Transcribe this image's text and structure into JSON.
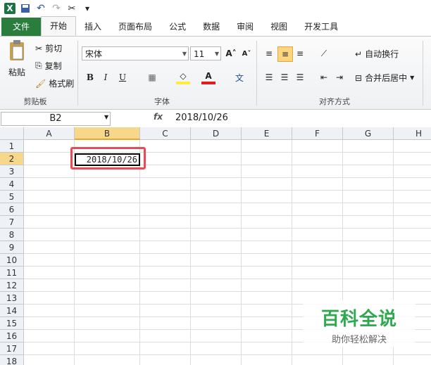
{
  "qat": {
    "dropdown_glyph": "▾"
  },
  "tabs": [
    "文件",
    "开始",
    "插入",
    "页面布局",
    "公式",
    "数据",
    "审阅",
    "视图",
    "开发工具"
  ],
  "clipboard": {
    "paste": "粘贴",
    "cut": "剪切",
    "copy": "复制",
    "format_painter": "格式刷",
    "group_label": "剪贴板"
  },
  "font": {
    "name": "宋体",
    "size": "11",
    "bold": "B",
    "italic": "I",
    "underline": "U",
    "group_label": "字体"
  },
  "align": {
    "wrap": "自动换行",
    "merge": "合并后居中",
    "group_label": "对齐方式"
  },
  "formula_bar": {
    "name_box": "B2",
    "fx": "fx",
    "value": "2018/10/26"
  },
  "columns": [
    "A",
    "B",
    "C",
    "D",
    "E",
    "F",
    "G",
    "H"
  ],
  "rows": [
    "1",
    "2",
    "3",
    "4",
    "5",
    "6",
    "7",
    "8",
    "9",
    "10",
    "11",
    "12",
    "13",
    "14",
    "15",
    "16",
    "17",
    "18"
  ],
  "cell_b2": "2018/10/26",
  "watermark": {
    "title": "百科全说",
    "subtitle": "助你轻松解决"
  },
  "colors": {
    "accent": "#2a7d3c",
    "highlight": "#e74c55",
    "watermark": "#2fa84f"
  }
}
